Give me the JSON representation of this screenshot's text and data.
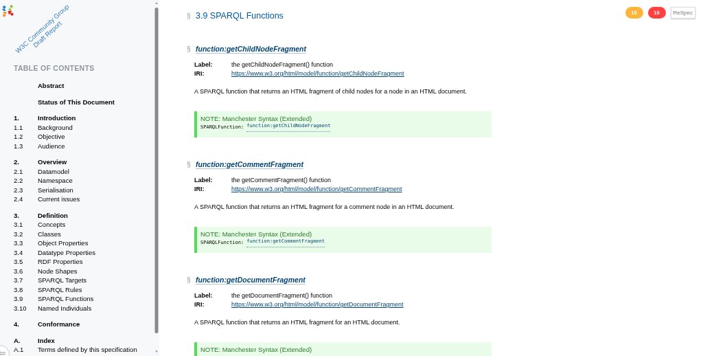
{
  "sidebar": {
    "logo_text": [
      "W3C Community Group",
      "Draft Report"
    ],
    "toc_title": "TABLE OF CONTENTS",
    "toc": [
      {
        "label": "Abstract"
      },
      {
        "label": "Status of This Document"
      },
      {
        "number": "1.",
        "label": "Introduction",
        "children": [
          {
            "number": "1.1",
            "label": "Background"
          },
          {
            "number": "1.2",
            "label": "Objective"
          },
          {
            "number": "1.3",
            "label": "Audience"
          }
        ]
      },
      {
        "number": "2.",
        "label": "Overview",
        "children": [
          {
            "number": "2.1",
            "label": "Datamodel"
          },
          {
            "number": "2.2",
            "label": "Namespace"
          },
          {
            "number": "2.3",
            "label": "Serialisation"
          },
          {
            "number": "2.4",
            "label": "Current issues"
          }
        ]
      },
      {
        "number": "3.",
        "label": "Definition",
        "children": [
          {
            "number": "3.1",
            "label": "Concepts"
          },
          {
            "number": "3.2",
            "label": "Classes"
          },
          {
            "number": "3.3",
            "label": "Object Properties"
          },
          {
            "number": "3.4",
            "label": "Datatype Properties"
          },
          {
            "number": "3.5",
            "label": "RDF Properties"
          },
          {
            "number": "3.6",
            "label": "Node Shapes"
          },
          {
            "number": "3.7",
            "label": "SPARQL Targets"
          },
          {
            "number": "3.8",
            "label": "SPARQL Rules"
          },
          {
            "number": "3.9",
            "label": "SPARQL Functions"
          },
          {
            "number": "3.10",
            "label": "Named Individuals"
          }
        ]
      },
      {
        "number": "4.",
        "label": "Conformance"
      },
      {
        "number": "A.",
        "label": "Index",
        "children": [
          {
            "number": "A.1",
            "label": "Terms defined by this specification"
          }
        ]
      }
    ]
  },
  "main": {
    "section_mark": "§",
    "section_title": "3.9 SPARQL Functions",
    "functions": [
      {
        "mark": "§",
        "name": "function:getChildNodeFragment",
        "fields": [
          {
            "key": "Label:",
            "value": "the getChildNodeFragment() function",
            "kind": "text"
          },
          {
            "key": "IRI:",
            "value": "https://www.w3.org/html/model/function/getChildNodeFragment",
            "kind": "link"
          }
        ],
        "description": "A SPARQL function that returns an HTML fragment of child nodes for a node in an HTML document.",
        "note": {
          "title": "NOTE: Manchester Syntax (Extended)",
          "code_label": "SPARQLFunction:",
          "code_link": "function:getChildNodeFragment"
        }
      },
      {
        "mark": "§",
        "name": "function:getCommentFragment",
        "fields": [
          {
            "key": "Label:",
            "value": "the getCommentFragment() function",
            "kind": "text"
          },
          {
            "key": "IRI:",
            "value": "https://www.w3.org/html/model/function/getCommentFragment",
            "kind": "link"
          }
        ],
        "description": "A SPARQL function that returns an HTML fragment for a comment node in an HTML document.",
        "note": {
          "title": "NOTE: Manchester Syntax (Extended)",
          "code_label": "SPARQLFunction:",
          "code_link": "function:getCommentFragment"
        }
      },
      {
        "mark": "§",
        "name": "function:getDocumentFragment",
        "fields": [
          {
            "key": "Label:",
            "value": "the getDocumentFragment() function",
            "kind": "text"
          },
          {
            "key": "IRI:",
            "value": "https://www.w3.org/html/model/function/getDocumentFragment",
            "kind": "link"
          }
        ],
        "description": "A SPARQL function that returns an HTML fragment for an HTML document.",
        "note": {
          "title": "NOTE: Manchester Syntax (Extended)"
        }
      }
    ]
  },
  "badges": [
    {
      "text": "10",
      "color": "#ffb53c"
    },
    {
      "text": "10",
      "color": "#ff4141"
    }
  ],
  "respec_button": "ReSpec"
}
